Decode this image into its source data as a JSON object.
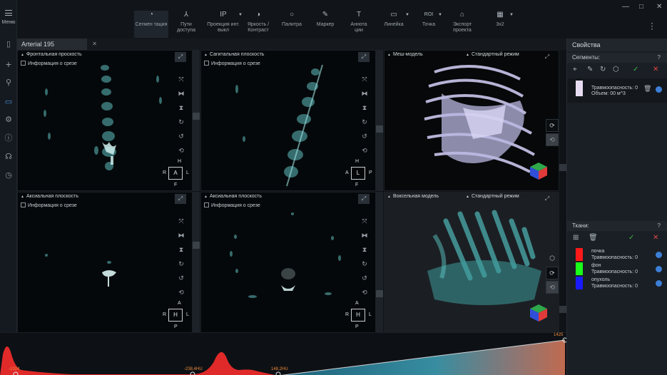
{
  "app": {
    "menu_label": "Меню",
    "window_controls": [
      "—",
      "□",
      "✕"
    ]
  },
  "toolbar": {
    "tools": [
      {
        "label": "Сегмен тация",
        "icon": "◔",
        "active": true
      },
      {
        "label": "Пути доступа",
        "icon": "⅄"
      },
      {
        "label": "Проекция инт. выкл",
        "icon": "IP"
      },
      {
        "label": "Яркость / Контраст",
        "icon": "◑"
      },
      {
        "label": "Палитра",
        "icon": "○"
      },
      {
        "label": "Маркер",
        "icon": "✎"
      },
      {
        "label": "Аннота ции",
        "icon": "T"
      },
      {
        "label": "Линейка",
        "icon": "▭"
      },
      {
        "label": "Точка",
        "icon": "ROI"
      },
      {
        "label": "Экспорт проекта",
        "icon": "⌂"
      },
      {
        "label": "3x2",
        "icon": "▦"
      }
    ]
  },
  "tab": {
    "label": "Arterial 195"
  },
  "viewports": {
    "frontal": {
      "title": "Фронтальная проскость",
      "info": "Информация о срезе",
      "top": "H",
      "left": "R",
      "center": "A",
      "right": "L",
      "bottom": "F"
    },
    "sagittal": {
      "title": "Сагитальная плоскость",
      "info": "Информация о срезе",
      "top": "H",
      "left": "A",
      "center": "L",
      "right": "P",
      "bottom": "F"
    },
    "mesh": {
      "title": "Меш-модель",
      "mode": "Стандартный режим"
    },
    "axial1": {
      "title": "Аксиальная плоскость",
      "info": "Информация о срезе",
      "top": "A",
      "left": "R",
      "center": "H",
      "right": "L",
      "bottom": "P"
    },
    "axial2": {
      "title": "Аксиальная плоскость",
      "info": "Информация о срезе",
      "top": "A",
      "left": "R",
      "center": "H",
      "right": "L",
      "bottom": "P"
    },
    "voxel": {
      "title": "Воксельная модель",
      "mode": "Стандартный режим"
    }
  },
  "panel": {
    "title": "Свойства",
    "segments": {
      "header": "Сегменты:",
      "help": "?",
      "items": [
        {
          "name_line": "Травмоопасность: 0",
          "volume": "Объем: 00 м^3",
          "color": "#e8dcf2"
        }
      ]
    },
    "tissues": {
      "header": "Ткани:",
      "help": "?",
      "items": [
        {
          "name": "почка",
          "risk": "Травмоопасность: 0",
          "color": "#ff1a1a"
        },
        {
          "name": "фон",
          "risk": "Травмоопасность: 0",
          "color": "#1aff1a"
        },
        {
          "name": "опухоль",
          "risk": "Травмоопасность: 0",
          "color": "#1a1aff"
        }
      ]
    }
  },
  "histogram": {
    "labels": {
      "min": "-1024",
      "mid1": "-238,4HU",
      "mid2": "148,2HU",
      "max": "1425"
    }
  }
}
